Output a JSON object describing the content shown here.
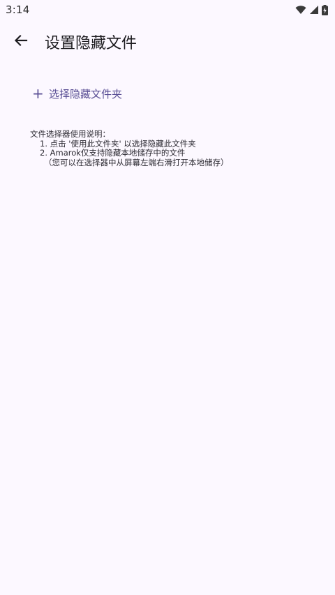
{
  "status_bar": {
    "time": "3:14",
    "icons": [
      "wifi-icon",
      "signal-icon",
      "battery-charging-icon"
    ]
  },
  "app_bar": {
    "back_icon": "arrow-back-icon",
    "title": "设置隐藏文件"
  },
  "add_folder": {
    "icon": "plus-icon",
    "icon_glyph": "+",
    "label": "选择隐藏文件夹"
  },
  "instructions": {
    "heading": "文件选择器使用说明：",
    "line1": "1. 点击 '使用此文件夹' 以选择隐藏此文件夹",
    "line2": "2. Amarok仅支持隐藏本地储存中的文件",
    "line3": "（您可以在选择器中从屏幕左端右滑打开本地储存）"
  },
  "colors": {
    "background": "#fcf8ff",
    "accent": "#5a4f95",
    "text": "#1c1b1f"
  }
}
